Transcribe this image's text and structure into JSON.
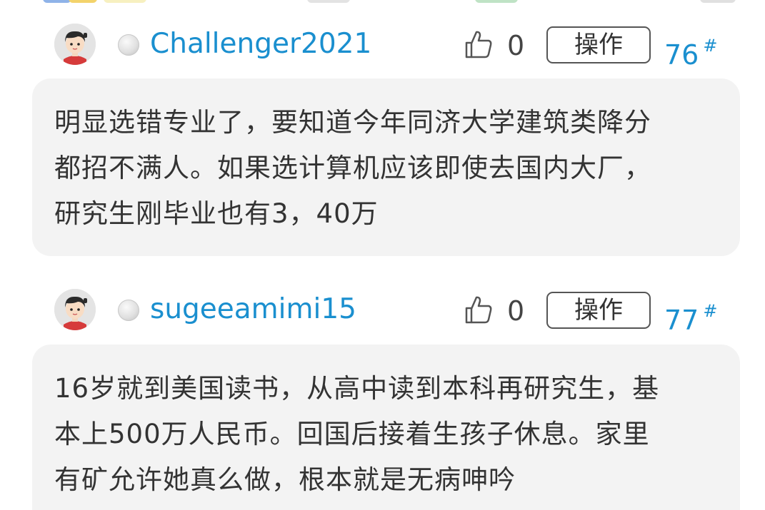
{
  "posts": [
    {
      "username": "Challenger2021",
      "likes": "0",
      "action_label": "操作",
      "floor": "76",
      "floor_symbol": "#",
      "content": "明显选错专业了，要知道今年同济大学建筑类降分\n都招不满人。如果选计算机应该即使去国内大厂，\n研究生刚毕业也有3，40万"
    },
    {
      "username": "sugeeamimi15",
      "likes": "0",
      "action_label": "操作",
      "floor": "77",
      "floor_symbol": "#",
      "content": "16岁就到美国读书，从高中读到本科再研究生，基\n本上500万人民币。回国后接着生孩子休息。家里\n有矿允许她真么做，根本就是无病呻吟"
    }
  ],
  "colors": {
    "username": "#1a8fcf",
    "floor": "#1a8fcf",
    "bubble_bg": "#f3f3f3",
    "text": "#333333"
  },
  "icons": {
    "like": "thumbs-up-icon",
    "online_status": "status-dot-icon",
    "avatar": "cartoon-avatar"
  }
}
